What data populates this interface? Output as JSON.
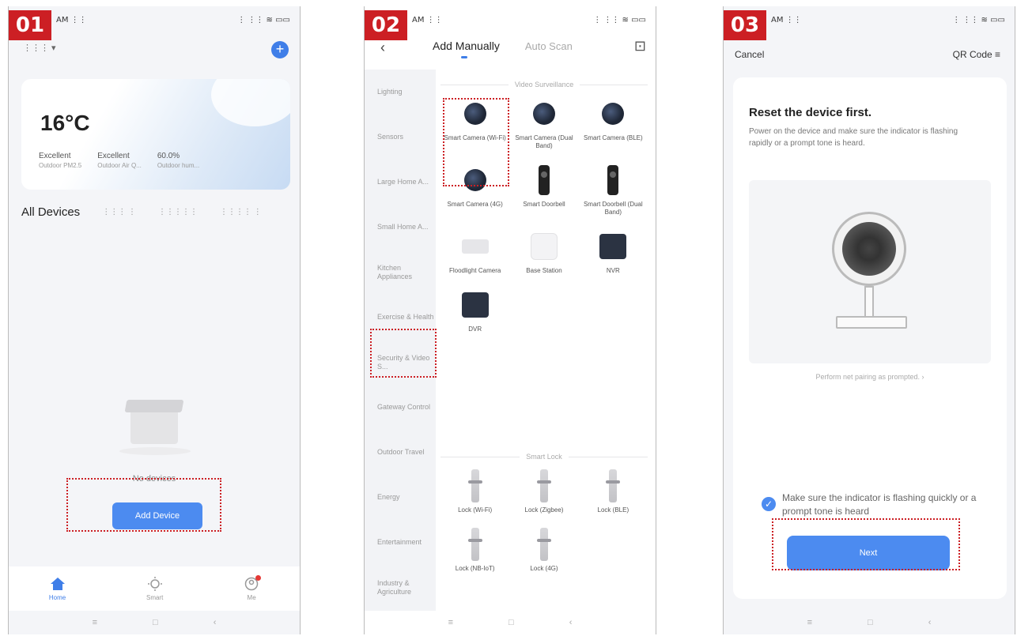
{
  "steps": [
    "01",
    "02",
    "03"
  ],
  "colors": {
    "accent": "#4c8bf0",
    "highlight": "#cc1f24"
  },
  "status": {
    "time": "AM ⋮⋮",
    "icons": "⋮ ⋮⋮ ≋ ▭▭"
  },
  "bottom_nav": {
    "menu": "≡",
    "home": "□",
    "back": "‹"
  },
  "screen1": {
    "home_selector": "⋮⋮⋮ ▾",
    "add_icon": "+",
    "weather": {
      "temperature": "16°C",
      "stats": [
        {
          "value": "Excellent",
          "label": "Outdoor PM2.5"
        },
        {
          "value": "Excellent",
          "label": "Outdoor Air Q..."
        },
        {
          "value": "60.0%",
          "label": "Outdoor hum..."
        }
      ]
    },
    "devices_title": "All Devices",
    "room_tabs": [
      "⋮⋮⋮ ⋮",
      "⋮⋮⋮⋮⋮",
      "⋮⋮⋮⋮ ⋮"
    ],
    "empty_text": "No devices",
    "add_button": "Add Device",
    "tabs": [
      {
        "label": "Home",
        "icon": "home-icon"
      },
      {
        "label": "Smart",
        "icon": "sun-icon"
      },
      {
        "label": "Me",
        "icon": "person-icon"
      }
    ]
  },
  "screen2": {
    "back": "‹",
    "tab_active": "Add Manually",
    "tab_inactive": "Auto Scan",
    "scan_icon": "⊡",
    "categories": [
      "Lighting",
      "Sensors",
      "Large Home A...",
      "Small Home A...",
      "Kitchen Appliances",
      "Exercise & Health",
      "Security & Video S...",
      "Gateway Control",
      "Outdoor Travel",
      "Energy",
      "Entertainment",
      "Industry & Agriculture"
    ],
    "video_section": "Video Surveillance",
    "video_devices": [
      {
        "name": "Smart Camera (Wi-Fi)",
        "type": "camera"
      },
      {
        "name": "Smart Camera (Dual Band)",
        "type": "camera"
      },
      {
        "name": "Smart Camera (BLE)",
        "type": "camera"
      },
      {
        "name": "Smart Camera (4G)",
        "type": "camera"
      },
      {
        "name": "Smart Doorbell",
        "type": "doorbell"
      },
      {
        "name": "Smart Doorbell (Dual Band)",
        "type": "doorbell"
      },
      {
        "name": "Floodlight Camera",
        "type": "flood"
      },
      {
        "name": "Base Station",
        "type": "base"
      },
      {
        "name": "NVR",
        "type": "nvr"
      },
      {
        "name": "DVR",
        "type": "nvr"
      }
    ],
    "lock_section": "Smart Lock",
    "lock_devices": [
      {
        "name": "Lock (Wi-Fi)",
        "type": "lock"
      },
      {
        "name": "Lock (Zigbee)",
        "type": "lock"
      },
      {
        "name": "Lock (BLE)",
        "type": "lock"
      },
      {
        "name": "Lock (NB-IoT)",
        "type": "lock"
      },
      {
        "name": "Lock (4G)",
        "type": "lock"
      }
    ]
  },
  "screen3": {
    "cancel": "Cancel",
    "qr_code": "QR Code ≡",
    "title": "Reset the device first.",
    "description": "Power on the device and make sure the indicator is flashing rapidly or a prompt tone is heard.",
    "perform_link": "Perform net pairing as prompted. ›",
    "confirm_text": "Make sure the indicator is flashing quickly or a prompt tone is heard",
    "check_icon": "✓",
    "next_button": "Next"
  }
}
